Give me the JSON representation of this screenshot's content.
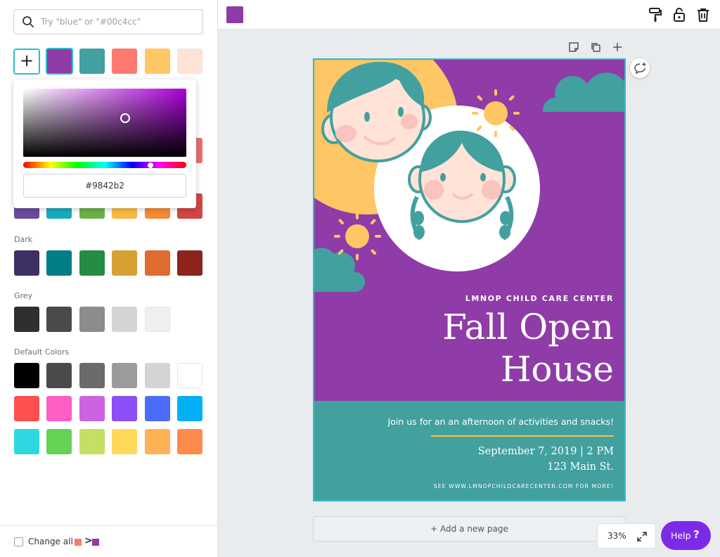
{
  "search": {
    "placeholder": "Try \"blue\" or \"#00c4cc\""
  },
  "add_color": {
    "label": "+"
  },
  "document_colors": [
    "#8f3ba8",
    "#42a09f",
    "#fe7970",
    "#fec664",
    "#fee3d6"
  ],
  "hidden_row_colors": [
    "#e86c6c"
  ],
  "bright_partial": [
    "#6a4b9e",
    "#17aabc",
    "#6cb049",
    "#f8b942",
    "#f58b36",
    "#d24545"
  ],
  "sections": {
    "dark": {
      "label": "Dark",
      "colors": [
        "#3e3062",
        "#007d86",
        "#268c43",
        "#d6a035",
        "#de6b2f",
        "#8c241e"
      ]
    },
    "grey": {
      "label": "Grey",
      "colors": [
        "#2f2f2f",
        "#4a4a4a",
        "#8c8c8c",
        "#d4d4d4",
        "#efefef"
      ]
    },
    "default": {
      "label": "Default Colors",
      "colors": [
        "#000000",
        "#4a4a4a",
        "#6b6b6b",
        "#9b9b9b",
        "#d4d4d4",
        "#ffffff",
        "#ff4f4f",
        "#ff5ec4",
        "#cb63e0",
        "#8c4ef5",
        "#4b6cf8",
        "#03b0f5",
        "#2fd8e0",
        "#65d155",
        "#c3e062",
        "#fed858",
        "#feb155",
        "#fe8a4c"
      ]
    }
  },
  "picker": {
    "hex": "#9842b2"
  },
  "footer": {
    "change_all_label": "Change all",
    "arrow": ">",
    "from_color": "#fe7970",
    "to_color": "#8f3ba8"
  },
  "toolbar": {
    "current_color": "#8f3ba8"
  },
  "poster": {
    "kicker": "LMNOP CHILD CARE CENTER",
    "headline_1": "Fall Open",
    "headline_2": "House",
    "tagline": "Join us for an an afternoon of activities and snacks!",
    "date": "September 7, 2019 | 2 PM",
    "address": "123 Main St.",
    "footnote": "SEE WWW.LMNOPCHILDCARECENTER.COM FOR MORE!",
    "colors": {
      "purple": "#8f3ba8",
      "teal": "#42a09f",
      "sun": "#fec664",
      "skin": "#fee3d6",
      "cheek": "#fbc3bd",
      "accent": "#f6c24c"
    }
  },
  "canvas": {
    "add_page_label": "+ Add a new page",
    "zoom": "33%",
    "help_label": "Help",
    "help_icon": "?"
  }
}
